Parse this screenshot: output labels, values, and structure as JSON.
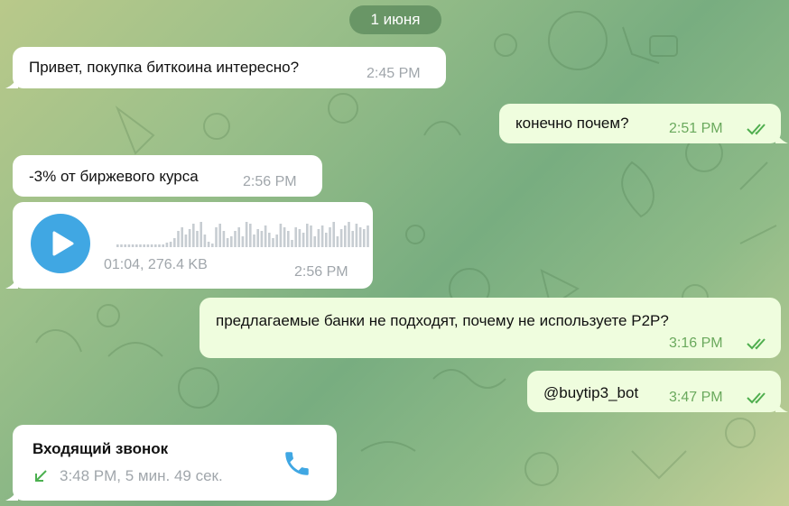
{
  "date_label": "1 июня",
  "messages": [
    {
      "text": "Привет, покупка биткоина интересно?",
      "time": "2:45 PM"
    },
    {
      "text": "конечно почем?",
      "time": "2:51 PM"
    },
    {
      "text": "-3% от биржевого курса",
      "time": "2:56 PM"
    },
    {
      "meta": "01:04, 276.4 KB",
      "time": "2:56 PM"
    },
    {
      "text": "предлагаемые банки не подходят, почему не используете P2P?",
      "time": "3:16 PM"
    },
    {
      "text": "@buytip3_bot",
      "time": "3:47 PM"
    }
  ],
  "call": {
    "title": "Входящий звонок",
    "details": "3:48 PM, 5 мин. 49 сек."
  },
  "colors": {
    "incoming": "#ffffff",
    "outgoing": "#effdde",
    "accent": "#40a7e3",
    "read_ticks": "#4fae4e",
    "call_green": "#4cb050"
  },
  "voice_wave": [
    3,
    3,
    3,
    3,
    3,
    3,
    3,
    3,
    3,
    3,
    3,
    3,
    3,
    5,
    6,
    10,
    18,
    22,
    14,
    20,
    26,
    18,
    28,
    14,
    6,
    4,
    22,
    26,
    18,
    10,
    12,
    18,
    22,
    12,
    28,
    26,
    14,
    20,
    18,
    24,
    16,
    10,
    14,
    26,
    22,
    18,
    8,
    22,
    20,
    16,
    26,
    24,
    12,
    20,
    24,
    16,
    22,
    28,
    12,
    20,
    24,
    28,
    18,
    26,
    22,
    20,
    24
  ]
}
